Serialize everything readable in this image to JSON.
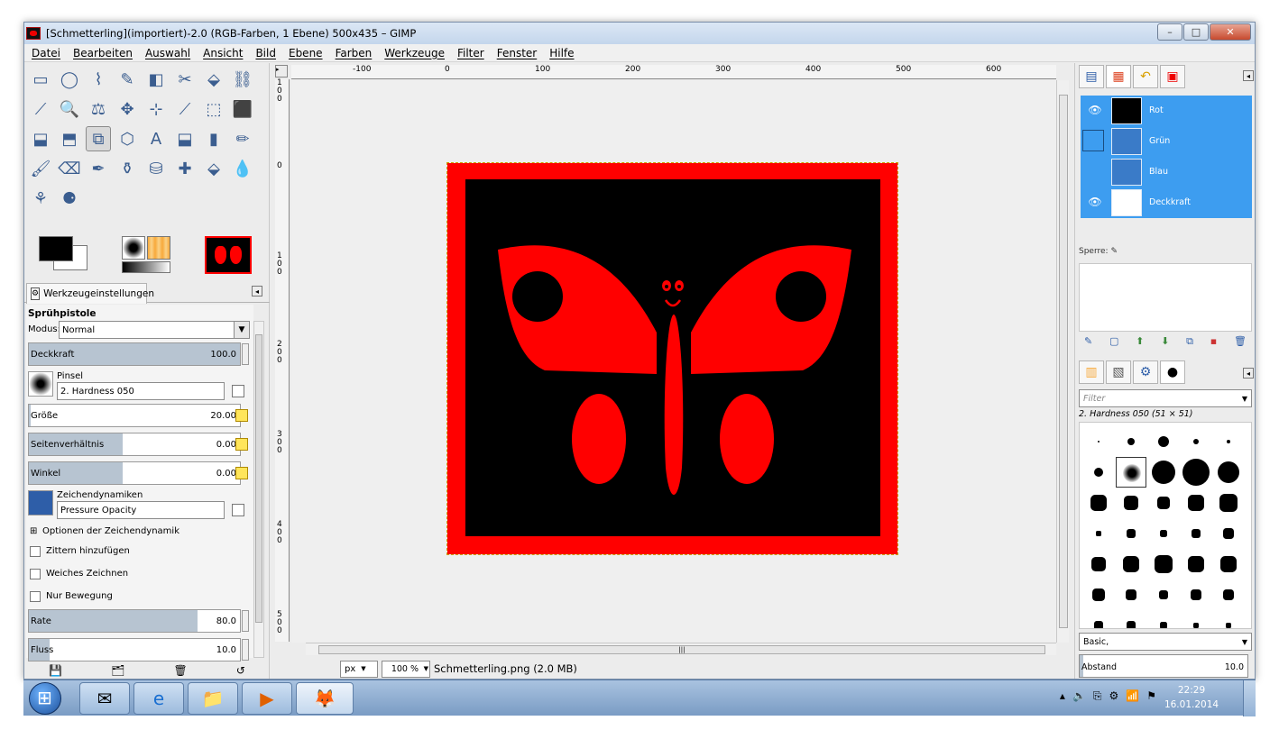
{
  "window": {
    "title": "[Schmetterling](importiert)-2.0 (RGB-Farben, 1 Ebene) 500x435 – GIMP",
    "controls": [
      "–",
      "□",
      "✕"
    ]
  },
  "menu": [
    "Datei",
    "Bearbeiten",
    "Auswahl",
    "Ansicht",
    "Bild",
    "Ebene",
    "Farben",
    "Werkzeuge",
    "Filter",
    "Fenster",
    "Hilfe"
  ],
  "toolbox": {
    "tools": [
      "▭",
      "◯",
      "⌇",
      "✎",
      "◧",
      "✂",
      "⬙",
      "⛓",
      "⟋",
      "🔍",
      "⚖",
      "✥",
      "⊹",
      "⟋",
      "⬚",
      "⬛",
      "⬓",
      "⬒",
      "⧉",
      "⬡",
      "A",
      "⬓",
      "▮",
      "✏",
      "🖌",
      "⌫",
      "✒",
      "⚱",
      "⛁",
      "✚",
      "⬙",
      "💧",
      "⚘",
      "⚈"
    ],
    "active_tool_index": 18,
    "colors": {
      "fg": "#000000",
      "bg": "#ffffff",
      "image_bg": "#000000",
      "image_border": "#ff0000"
    }
  },
  "tool_options": {
    "tab_label": "Werkzeugeinstellungen",
    "title": "Sprühpistole",
    "mode_label": "Modus:",
    "mode_value": "Normal",
    "opacity_label": "Deckkraft",
    "opacity_value": "100.0",
    "opacity_fraction": 1.0,
    "brush_label": "Pinsel",
    "brush_value": "2. Hardness 050",
    "size_label": "Größe",
    "size_value": "20.00",
    "aspect_label": "Seitenverhältnis",
    "aspect_value": "0.00",
    "angle_label": "Winkel",
    "angle_value": "0.00",
    "dynamics_label": "Zeichendynamiken",
    "dynamics_value": "Pressure Opacity",
    "dynamics_options": "Optionen der Zeichendynamik",
    "jitter": "Zittern hinzufügen",
    "smooth": "Weiches Zeichnen",
    "motion_only": "Nur Bewegung",
    "rate_label": "Rate",
    "rate_value": "80.0",
    "rate_fraction": 0.8,
    "flow_label": "Fluss",
    "flow_value": "10.0",
    "flow_fraction": 0.1
  },
  "rulers": {
    "h_labels": [
      "-100",
      "0",
      "100",
      "200",
      "300",
      "400",
      "500",
      "600"
    ],
    "v_labels": [
      "1\n0\n0",
      "0",
      "1\n0\n0",
      "2\n0\n0",
      "3\n0\n0",
      "4\n0\n0",
      "5\n0\n0"
    ]
  },
  "status": {
    "unit": "px",
    "zoom": "100 %",
    "file": "Schmetterling.png (2.0 MB)"
  },
  "layers": {
    "items": [
      {
        "name": "Rot",
        "visible": true
      },
      {
        "name": "Grün",
        "visible": false
      },
      {
        "name": "Blau",
        "visible": false
      },
      {
        "name": "Deckkraft",
        "visible": true
      }
    ],
    "lock_label": "Sperre:"
  },
  "brushes": {
    "filter_placeholder": "Filter",
    "selected_name": "2. Hardness 050 (51 × 51)",
    "preset": "Basic,",
    "spacing_label": "Abstand",
    "spacing_value": "10.0"
  },
  "taskbar": {
    "time": "22:29",
    "date": "16.01.2014"
  }
}
